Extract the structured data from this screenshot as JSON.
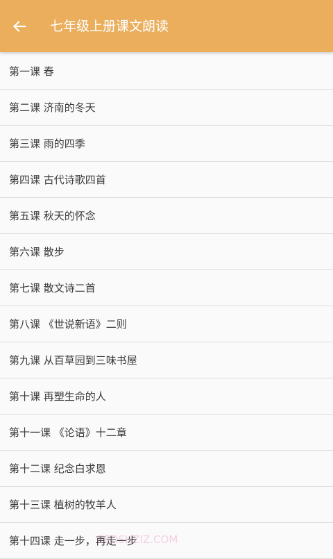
{
  "appbar": {
    "back_icon": "arrow-left-icon",
    "title": "七年级上册课文朗读",
    "background": "#eaae5c"
  },
  "lessons": [
    "第一课 春",
    "第二课 济南的冬天",
    "第三课 雨的四季",
    "第四课 古代诗歌四首",
    "第五课 秋天的怀念",
    "第六课 散步",
    "第七课 散文诗二首",
    "第八课 《世说新语》二则",
    "第九课 从百草园到三味书屋",
    "第十课 再塑生命的人",
    "第十一课 《论语》十二章",
    "第十二课 纪念白求恩",
    "第十三课 植树的牧羊人",
    "第十四课 走一步，再走一步"
  ],
  "watermark": "EEDSHZIZ.COM"
}
